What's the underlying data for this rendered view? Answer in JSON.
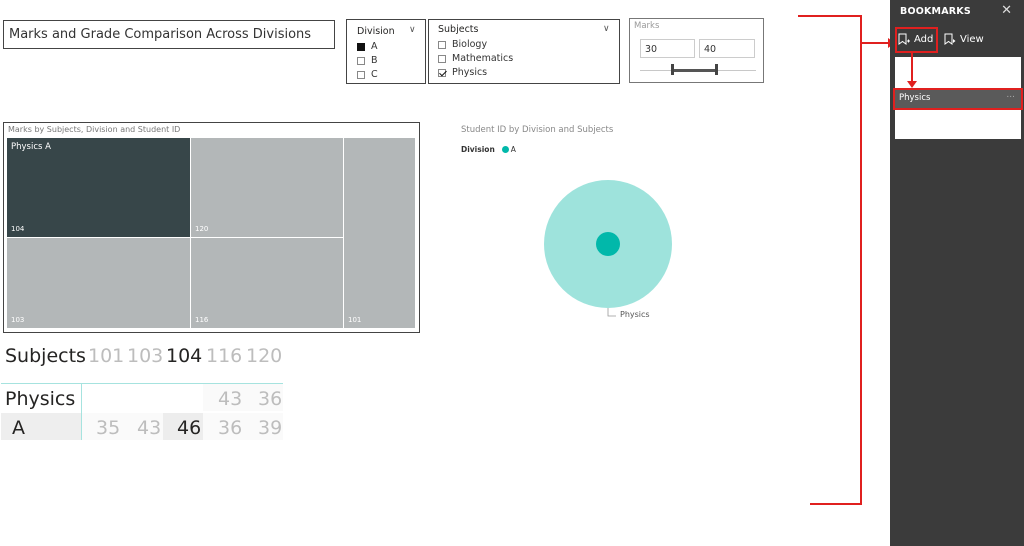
{
  "title": "Marks and Grade Comparison Across Divisions",
  "division_slicer": {
    "header": "Division",
    "options": [
      {
        "label": "A",
        "state": "selected"
      },
      {
        "label": "B",
        "state": "unselected"
      },
      {
        "label": "C",
        "state": "unselected"
      }
    ]
  },
  "subjects_slicer": {
    "header": "Subjects",
    "options": [
      {
        "label": "Biology",
        "state": "unselected"
      },
      {
        "label": "Mathematics",
        "state": "unselected"
      },
      {
        "label": "Physics",
        "state": "checked"
      }
    ]
  },
  "marks_slicer": {
    "header": "Marks",
    "min_value": "30",
    "max_value": "40"
  },
  "treemap": {
    "title": "Marks by Subjects, Division and Student ID",
    "group_label": "Physics A",
    "tiles": [
      {
        "label": "104",
        "value": 46
      },
      {
        "label": "120",
        "value": 39
      },
      {
        "label": "103",
        "value": 43
      },
      {
        "label": "116",
        "value": 36
      },
      {
        "label": "101",
        "value": 35
      }
    ]
  },
  "chart_data": {
    "type": "pie",
    "title": "Student ID by Division and Subjects",
    "legend_title": "Division",
    "legend": [
      "A"
    ],
    "colors": {
      "outer": "#9ee3dc",
      "inner": "#01b8aa"
    },
    "series": [
      {
        "name": "A",
        "values": [
          1
        ]
      }
    ],
    "slice_label": "Physics"
  },
  "matrix": {
    "corner_label": "Subjects",
    "column_headers": [
      "101",
      "103",
      "104",
      "116",
      "120"
    ],
    "rows": [
      {
        "label": "Physics",
        "values": [
          "",
          "",
          "",
          "43",
          "36"
        ]
      },
      {
        "label": "A",
        "values": [
          "35",
          "43",
          "46",
          "36",
          "39"
        ]
      }
    ]
  },
  "bookmarks": {
    "title": "BOOKMARKS",
    "close_icon": "close-icon",
    "add_label": "Add",
    "view_label": "View",
    "items": [
      {
        "label": "Physics",
        "more": "..."
      }
    ]
  },
  "colors": {
    "annotation_red": "#e0201f",
    "pane_bg": "#3b3b3b",
    "treemap_dark": "#374649",
    "treemap_light": "#b3b7b8"
  }
}
